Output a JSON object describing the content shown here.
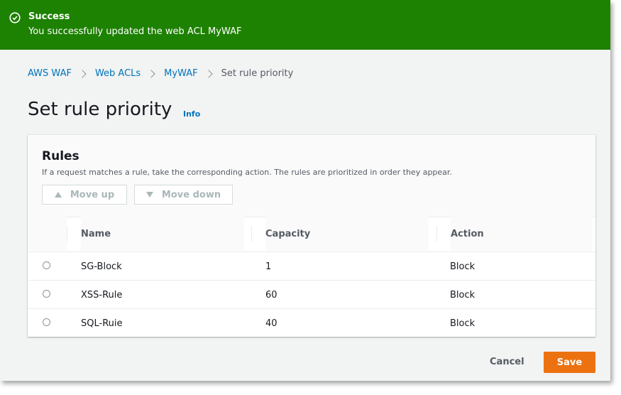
{
  "flash": {
    "title": "Success",
    "message": "You successfully updated the web ACL MyWAF",
    "color": "#1d8102",
    "icon": "check-circle-icon"
  },
  "breadcrumb": {
    "items": [
      "AWS WAF",
      "Web ACLs",
      "MyWAF"
    ],
    "current": "Set rule priority"
  },
  "page": {
    "title": "Set rule priority",
    "info_label": "Info"
  },
  "rules": {
    "title": "Rules",
    "description": "If a request matches a rule, take the corresponding action. The rules are prioritized in order they appear.",
    "move_up_label": "Move up",
    "move_down_label": "Move down",
    "columns": [
      "Name",
      "Capacity",
      "Action"
    ],
    "rows": [
      {
        "name": "SG-Block",
        "capacity": "1",
        "action": "Block"
      },
      {
        "name": "XSS-Rule",
        "capacity": "60",
        "action": "Block"
      },
      {
        "name": "SQL-Ruie",
        "capacity": "40",
        "action": "Block"
      }
    ]
  },
  "footer": {
    "cancel_label": "Cancel",
    "save_label": "Save",
    "save_color": "#ec7211"
  }
}
